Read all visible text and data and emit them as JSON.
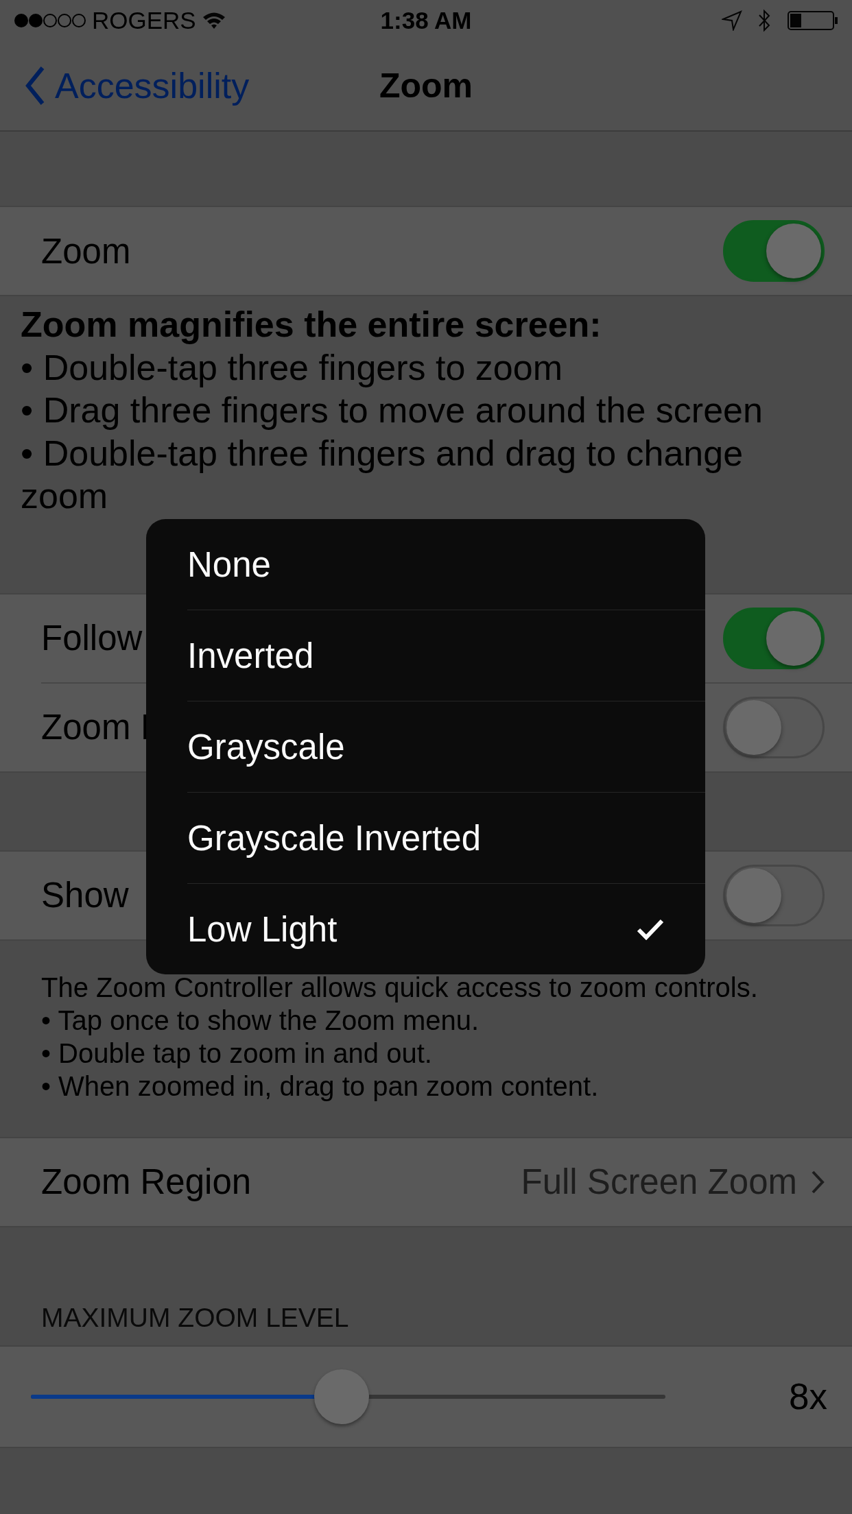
{
  "status_bar": {
    "carrier": "ROGERS",
    "time": "1:38 AM"
  },
  "nav": {
    "back": "Accessibility",
    "title": "Zoom"
  },
  "sections": [
    {
      "rows": [
        {
          "kind": "toggle",
          "label": "Zoom",
          "on": true
        }
      ],
      "footer": {
        "kind": "bullets",
        "heading": "Zoom magnifies the entire screen:",
        "lines": [
          "•  Double-tap three fingers to zoom",
          "•  Drag three fingers to move around the screen",
          "•  Double-tap three fingers and drag to change zoom"
        ]
      }
    },
    {
      "rows": [
        {
          "kind": "toggle",
          "label": "Follow",
          "on": true
        },
        {
          "kind": "toggle",
          "label": "Zoom I",
          "on": false
        }
      ]
    },
    {
      "rows": [
        {
          "kind": "toggle",
          "label": "Show",
          "on": false
        }
      ],
      "footer": {
        "kind": "plain",
        "lines": [
          "The Zoom Controller allows quick access to zoom controls.",
          "• Tap once to show the Zoom menu.",
          "• Double tap to zoom in and out.",
          "• When zoomed in, drag to pan zoom content."
        ]
      }
    },
    {
      "rows": [
        {
          "kind": "disclosure",
          "label": "Zoom Region",
          "value": "Full Screen Zoom"
        }
      ]
    },
    {
      "header": "MAXIMUM ZOOM LEVEL",
      "rows": [
        {
          "kind": "slider",
          "level": 0.49,
          "reading": "8x"
        }
      ]
    }
  ],
  "menu": [
    {
      "label": "None",
      "selected": false
    },
    {
      "label": "Inverted",
      "selected": false
    },
    {
      "label": "Grayscale",
      "selected": false
    },
    {
      "label": "Grayscale Inverted",
      "selected": false
    },
    {
      "label": "Low Light",
      "selected": true
    }
  ]
}
